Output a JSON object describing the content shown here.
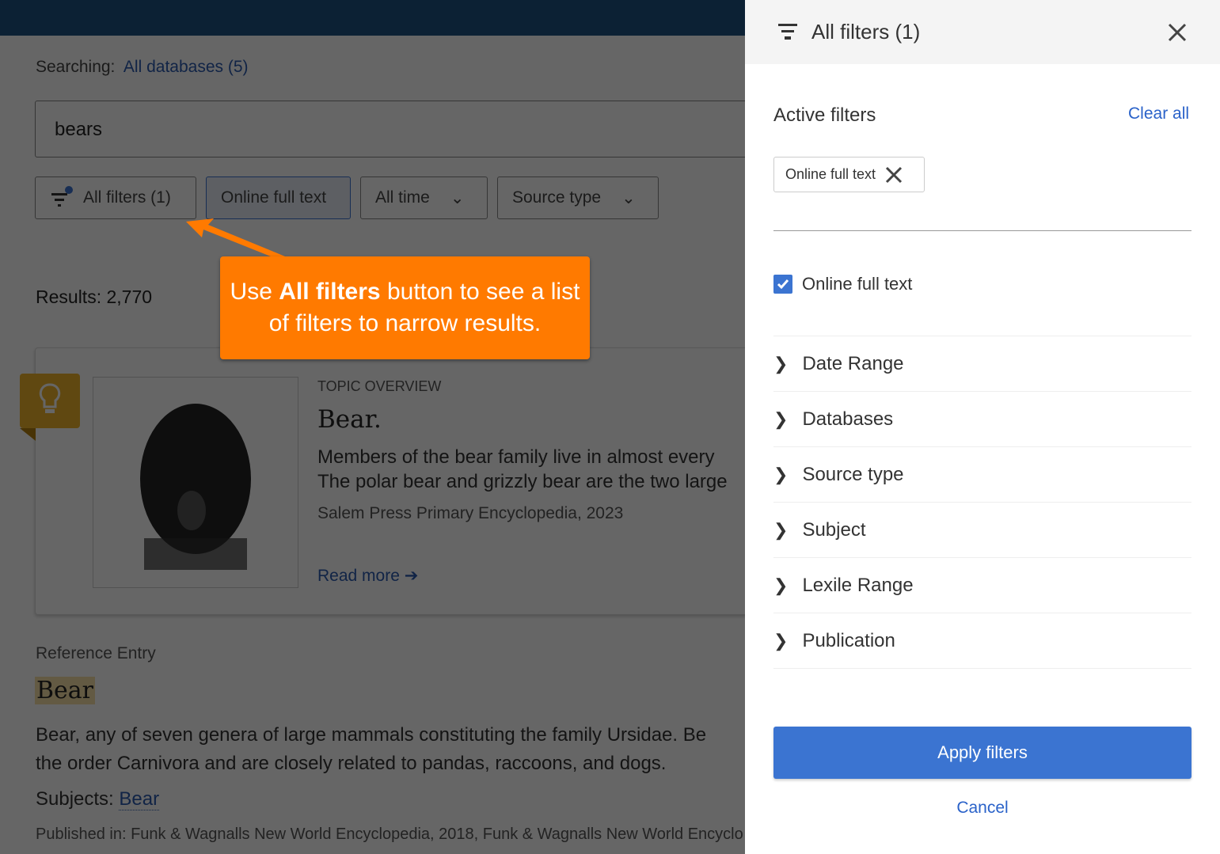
{
  "search": {
    "searching_label": "Searching:",
    "databases_link": "All databases (5)",
    "query": "bears"
  },
  "chips": {
    "all_filters": "All filters (1)",
    "online_full_text": "Online full text",
    "all_time": "All time",
    "source_type": "Source type"
  },
  "results": {
    "count_label": "Results: 2,770"
  },
  "topic_card": {
    "kicker": "TOPIC OVERVIEW",
    "title": "Bear.",
    "line1": "Members of the bear family live in almost every",
    "line2": "The polar bear and grizzly bear are the two large",
    "source": "Salem Press Primary Encyclopedia, 2023",
    "read_more": "Read more"
  },
  "reference": {
    "kicker": "Reference Entry",
    "title": "Bear",
    "line1": "Bear, any of seven genera of large mammals constituting the family Ursidae. Be",
    "line2": "the order Carnivora and are closely related to pandas, raccoons, and dogs.",
    "subjects_label": "Subjects:",
    "subject_link": "Bear",
    "published": "Published in: Funk & Wagnalls New World Encyclopedia, 2018, Funk & Wagnalls New World Encyclo"
  },
  "callout": {
    "pre": "Use ",
    "bold": "All filters",
    "post": " button to see a list of filters to narrow results."
  },
  "panel": {
    "title": "All filters (1)",
    "active_filters": "Active filters",
    "clear_all": "Clear all",
    "active_chip": "Online full text",
    "checkbox_label": "Online full text",
    "checkbox_checked": true,
    "sections": [
      "Date Range",
      "Databases",
      "Source type",
      "Subject",
      "Lexile Range",
      "Publication"
    ],
    "apply": "Apply filters",
    "cancel": "Cancel"
  },
  "colors": {
    "accent": "#3b74d1",
    "callout": "#ff7a00",
    "header": "#0c2033"
  }
}
